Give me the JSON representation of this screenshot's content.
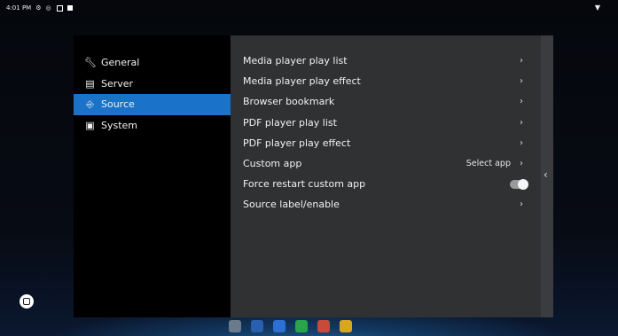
{
  "status_bar": {
    "time": "4:01 PM",
    "icons": [
      "settings-gear-icon",
      "location-icon",
      "screenshot-icon",
      "notification-icon"
    ],
    "right_icon": "wifi-icon"
  },
  "sidebar": {
    "items": [
      {
        "label": "General",
        "icon": "wrench-icon",
        "active": false
      },
      {
        "label": "Server",
        "icon": "server-icon",
        "active": false
      },
      {
        "label": "Source",
        "icon": "input-source-icon",
        "active": true
      },
      {
        "label": "System",
        "icon": "system-icon",
        "active": false
      }
    ]
  },
  "content": {
    "rows": [
      {
        "label": "Media player play list",
        "value": "",
        "control": "chevron"
      },
      {
        "label": "Media player play effect",
        "value": "",
        "control": "chevron"
      },
      {
        "label": "Browser bookmark",
        "value": "",
        "control": "chevron"
      },
      {
        "label": "PDF player play list",
        "value": "",
        "control": "chevron"
      },
      {
        "label": "PDF player play effect",
        "value": "",
        "control": "chevron"
      },
      {
        "label": "Custom app",
        "value": "Select app",
        "control": "chevron"
      },
      {
        "label": "Force restart custom app",
        "value": "",
        "control": "toggle"
      },
      {
        "label": "Source label/enable",
        "value": "",
        "control": "chevron"
      }
    ]
  },
  "colors": {
    "accent": "#1a73c8",
    "panel": "#2f3133",
    "sidebar": "#000000"
  }
}
